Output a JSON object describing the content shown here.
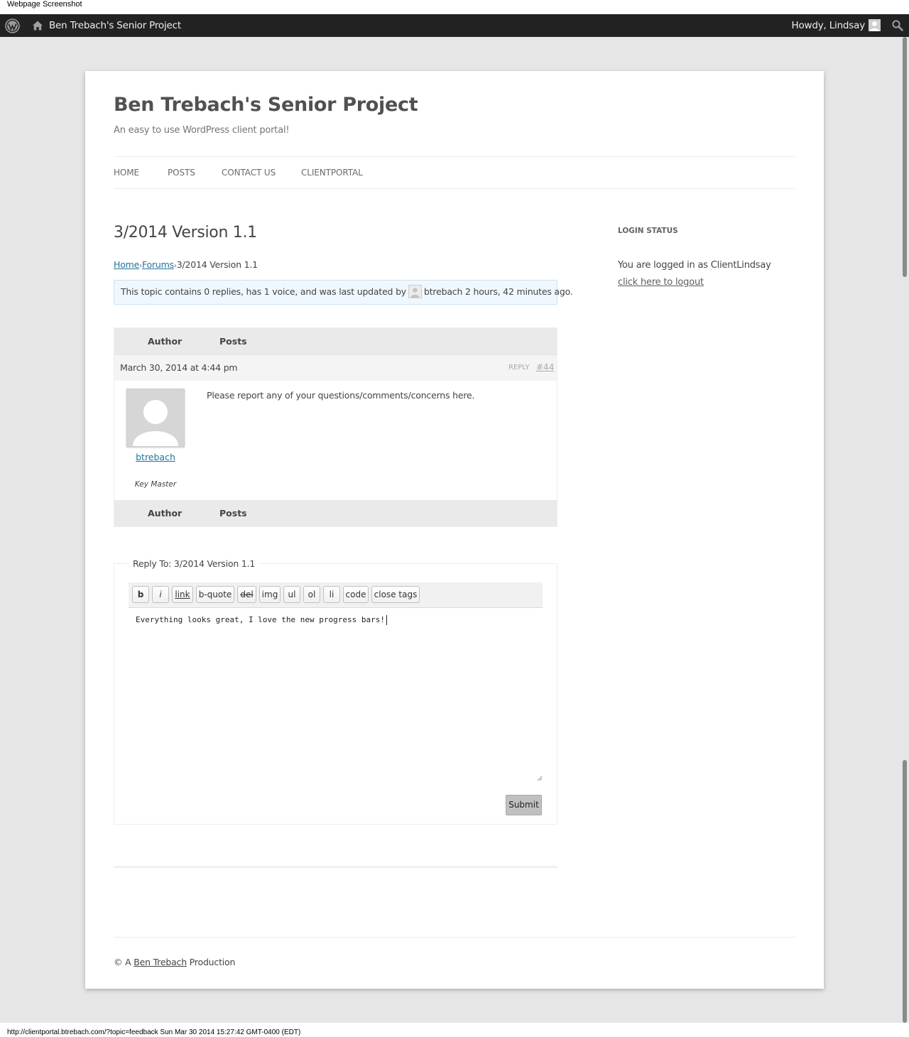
{
  "capture": {
    "label": "Webpage Screenshot",
    "footer": "http://clientportal.btrebach.com/?topic=feedback Sun Mar 30 2014 15:27:42 GMT-0400 (EDT)"
  },
  "adminbar": {
    "site_name": "Ben Trebach's Senior Project",
    "greeting": "Howdy, Lindsay",
    "icons": [
      "wordpress-logo-icon",
      "home-icon",
      "user-avatar-icon",
      "search-icon"
    ]
  },
  "site": {
    "title": "Ben Trebach's Senior Project",
    "description": "An easy to use WordPress client portal!"
  },
  "nav": {
    "items": [
      {
        "label": "HOME"
      },
      {
        "label": "POSTS"
      },
      {
        "label": "CONTACT US"
      },
      {
        "label": "CLIENTPORTAL"
      }
    ]
  },
  "topic": {
    "title": "3/2014 Version 1.1",
    "breadcrumb": {
      "home": "Home",
      "separator": "›",
      "forums": "Forums",
      "current": "3/2014 Version 1.1"
    },
    "notice": {
      "prefix": "This topic contains 0 replies, has 1 voice, and was last updated by",
      "user": "btrebach",
      "time": "2 hours, 42 minutes ago."
    }
  },
  "replies": {
    "header": {
      "author": "Author",
      "posts": "Posts"
    },
    "items": [
      {
        "date": "March 30, 2014 at 4:44 pm",
        "reply_label": "REPLY",
        "permalink": "#44",
        "author": "btrebach",
        "role": "Key Master",
        "content": "Please report any of your questions/comments/concerns here."
      }
    ],
    "footer": {
      "author": "Author",
      "posts": "Posts"
    }
  },
  "reply_form": {
    "legend": "Reply To: 3/2014 Version 1.1",
    "toolbar": [
      "b",
      "i",
      "link",
      "b-quote",
      "del",
      "img",
      "ul",
      "ol",
      "li",
      "code",
      "close tags"
    ],
    "text": "Everything looks great, I love the new progress bars!",
    "submit_label": "Submit"
  },
  "footer": {
    "prefix": "© A",
    "link": "Ben Trebach",
    "suffix": "Production"
  },
  "sidebar": {
    "widget_title": "LOGIN STATUS",
    "status": "You are logged in as ClientLindsay",
    "logout": "click here to logout"
  },
  "colors": {
    "admin_bar": "#222222",
    "link": "#21759b",
    "notice_bg": "#f0f8ff",
    "page_bg": "#e6e6e6"
  }
}
